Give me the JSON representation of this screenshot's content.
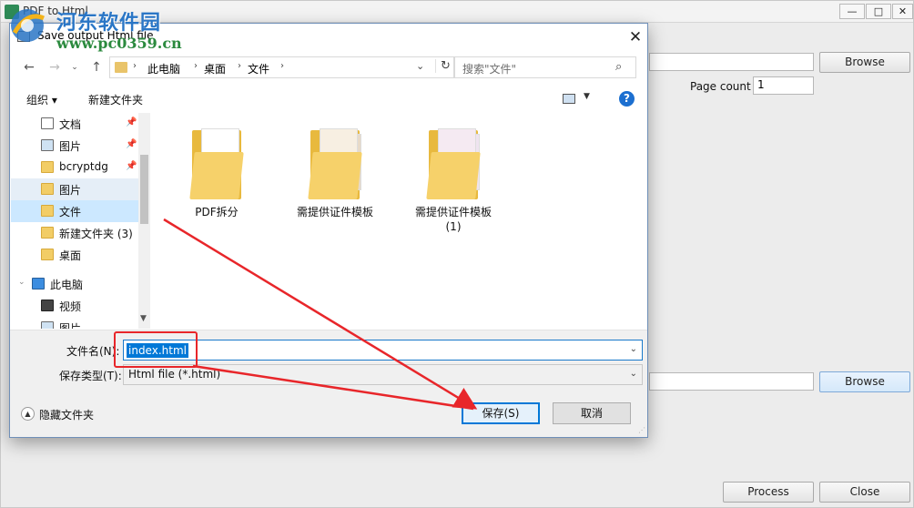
{
  "app": {
    "title": "PDF to Html",
    "browse_top": "Browse",
    "page_count_label": "Page count",
    "page_count_value": "1",
    "browse_bottom": "Browse",
    "process": "Process",
    "close": "Close",
    "window_controls": [
      "—",
      "□",
      "✕"
    ]
  },
  "dialog": {
    "title": "Save output Html file",
    "close_glyph": "✕",
    "breadcrumbs": [
      "此电脑",
      "桌面",
      "文件"
    ],
    "search_placeholder": "搜索\"文件\"",
    "toolbar": {
      "organize": "组织 ▾",
      "new_folder": "新建文件夹"
    },
    "nav_items": [
      {
        "label": "文档",
        "icon": "document-icon",
        "pinned": true
      },
      {
        "label": "图片",
        "icon": "picture-icon",
        "pinned": true
      },
      {
        "label": "bcryptdg",
        "icon": "folder-icon",
        "pinned": true
      },
      {
        "label": "图片",
        "icon": "folder-icon",
        "pinned": false
      },
      {
        "label": "文件",
        "icon": "folder-icon",
        "pinned": false
      },
      {
        "label": "新建文件夹 (3)",
        "icon": "folder-icon",
        "pinned": false
      },
      {
        "label": "桌面",
        "icon": "folder-icon",
        "pinned": false
      },
      {
        "label": "此电脑",
        "icon": "computer-icon",
        "pinned": false
      },
      {
        "label": "视频",
        "icon": "video-icon",
        "pinned": false
      },
      {
        "label": "图片",
        "icon": "picture-icon",
        "pinned": false
      }
    ],
    "files": [
      {
        "name": "PDF拆分"
      },
      {
        "name": "需提供证件模板"
      },
      {
        "name": "需提供证件模板\n(1)"
      }
    ],
    "filename_label": "文件名(N):",
    "filename_value": "index.html",
    "filetype_label": "保存类型(T):",
    "filetype_value": "Html file (*.html)",
    "hide_folders": "隐藏文件夹",
    "save": "保存(S)",
    "cancel": "取消"
  },
  "watermark": {
    "title": "河东软件园",
    "url": "www.pc0359.cn"
  },
  "colors": {
    "accent": "#0078d7",
    "annotation": "#e8262a",
    "watermark_blue": "#2a76c6",
    "watermark_green": "#2b8a3e"
  }
}
